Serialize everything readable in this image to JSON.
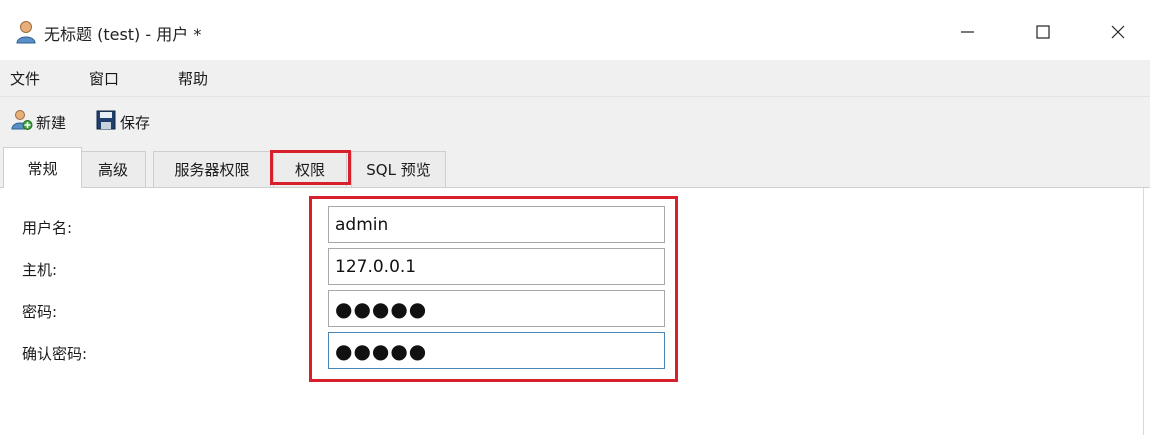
{
  "window": {
    "title": "无标题 (test) - 用户 *",
    "icon": "user-icon",
    "controls": [
      "minimize-icon",
      "maximize-icon",
      "close-icon"
    ]
  },
  "menu": {
    "items": [
      "文件",
      "窗口",
      "帮助"
    ]
  },
  "toolbar": {
    "new_label": "新建",
    "new_icon": "new-user-icon",
    "save_label": "保存",
    "save_icon": "save-icon"
  },
  "tabs": [
    {
      "label": "常规",
      "active": true
    },
    {
      "label": "高级",
      "active": false
    },
    {
      "label": "服务器权限",
      "active": false
    },
    {
      "label": "权限",
      "active": false,
      "highlighted": true
    },
    {
      "label": "SQL 预览",
      "active": false
    }
  ],
  "form": {
    "username": {
      "label": "用户名:",
      "value": "admin"
    },
    "host": {
      "label": "主机:",
      "value": "127.0.0.1"
    },
    "password": {
      "label": "密码:",
      "value": "●●●●●"
    },
    "confirm_password": {
      "label": "确认密码:",
      "value": "●●●●●"
    }
  },
  "colors": {
    "highlight": "#d8202c",
    "chrome": "#f0f0f0",
    "focus_border": "#4a86b8"
  }
}
